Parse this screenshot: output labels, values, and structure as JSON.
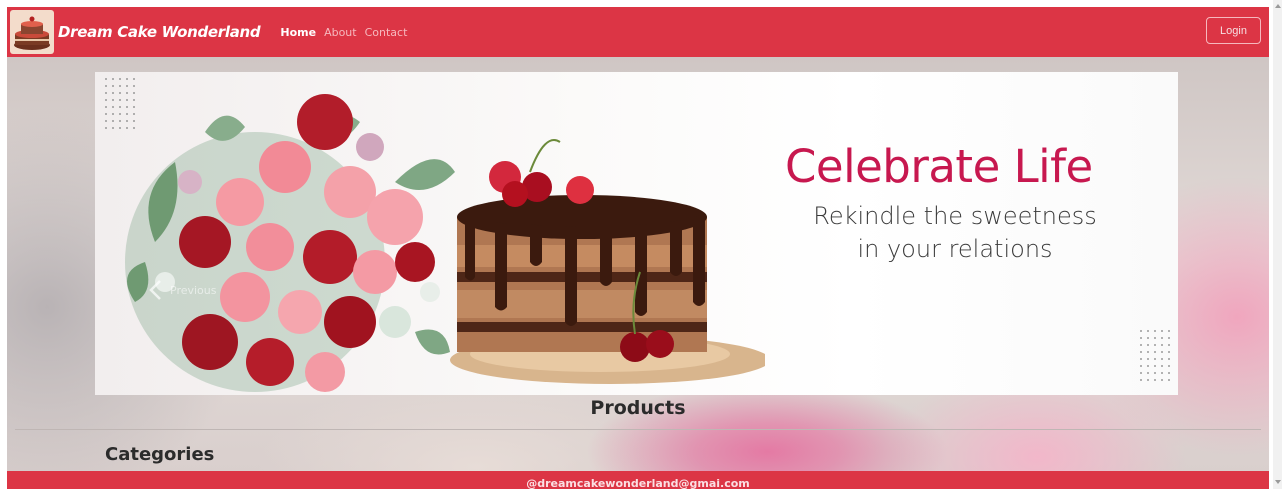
{
  "navbar": {
    "brand": "Dream Cake Wonderland",
    "links": [
      "Home",
      "About",
      "Contact"
    ],
    "login_label": "Login",
    "color": "#dc3545"
  },
  "banner": {
    "headline": "Celebrate Life",
    "tagline_line1": "Rekindle the sweetness",
    "tagline_line2": "in your relations",
    "headline_color": "#c7184f",
    "prev_label": "Previous"
  },
  "sections": {
    "products_title": "Products",
    "categories_title": "Categories"
  },
  "footer": {
    "text": "@dreamcakewonderland@gmai.com"
  },
  "icons": {
    "logo": "cake-logo-icon",
    "prev": "chevron-left-icon"
  }
}
